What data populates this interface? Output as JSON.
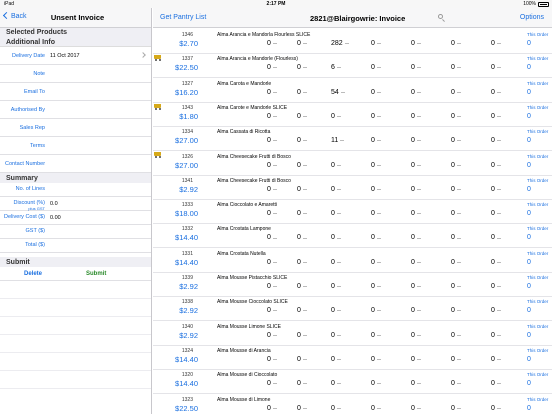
{
  "status": {
    "left": "iPad",
    "time": "2:17 PM",
    "battery": "100%"
  },
  "left_nav": {
    "back_label": "Back",
    "title": "Unsent Invoice"
  },
  "sections": {
    "selected": "Selected Products",
    "additional": "Additional Info",
    "summary": "Summary",
    "submit": "Submit"
  },
  "info_rows": [
    {
      "label": "Delivery Date",
      "value": "11 Oct 2017"
    },
    {
      "label": "Note",
      "value": ""
    },
    {
      "label": "Email To",
      "value": ""
    },
    {
      "label": "Authorised By",
      "value": ""
    },
    {
      "label": "Sales Rep",
      "value": ""
    },
    {
      "label": "Terms",
      "value": ""
    }
  ],
  "contact_label": "Contact Number",
  "summary_rows": [
    {
      "label": "No. of Lines",
      "sub": "",
      "value": ""
    },
    {
      "label": "Discount (%)",
      "sub": "plus GST",
      "value": "0.0"
    },
    {
      "label": "Delivery Cost ($)",
      "sub": "",
      "value": "0.00"
    },
    {
      "label": "GST ($)",
      "sub": "",
      "value": ""
    },
    {
      "label": "Total ($)",
      "sub": "",
      "value": ""
    }
  ],
  "buttons": {
    "delete": "Delete",
    "submit": "Submit"
  },
  "right_nav": {
    "pantry": "Get Pantry List",
    "title": "2821@Blairgowrie: Invoice",
    "options": "Options"
  },
  "order_label": "This Order",
  "products": [
    {
      "code": "1346",
      "price": "$2.70",
      "name": "Alma Arancia e Mandorla Flourless SLICE",
      "q": [
        "0",
        "0",
        "282",
        "0",
        "0",
        "0",
        "0"
      ],
      "order": "0"
    },
    {
      "code": "1337",
      "price": "$22.50",
      "name": "Alma Arancia e Mandorle (Flourless)",
      "q": [
        "0",
        "0",
        "6",
        "0",
        "0",
        "0",
        "0"
      ],
      "order": "0"
    },
    {
      "code": "1327",
      "price": "$16.20",
      "name": "Alma Carota e Mandorle",
      "q": [
        "0",
        "0",
        "54",
        "0",
        "0",
        "0",
        "0"
      ],
      "order": "0"
    },
    {
      "code": "1343",
      "price": "$1.80",
      "name": "Alma Carote e Mandorle SLICE",
      "q": [
        "0",
        "0",
        "0",
        "0",
        "0",
        "0",
        "0"
      ],
      "order": "0"
    },
    {
      "code": "1334",
      "price": "$27.00",
      "name": "Alma Cassata di Ricotta",
      "q": [
        "0",
        "0",
        "11",
        "0",
        "0",
        "0",
        "0"
      ],
      "order": "0"
    },
    {
      "code": "1326",
      "price": "$27.00",
      "name": "Alma Cheesecake Frutti di Bosco",
      "q": [
        "0",
        "0",
        "0",
        "0",
        "0",
        "0",
        "0"
      ],
      "order": "0"
    },
    {
      "code": "1341",
      "price": "$2.92",
      "name": "Alma Cheesecake Frutti di Bosco",
      "q": [
        "0",
        "0",
        "0",
        "0",
        "0",
        "0",
        "0"
      ],
      "order": "0"
    },
    {
      "code": "1333",
      "price": "$18.00",
      "name": "Alma Cioccolato e Amaretti",
      "q": [
        "0",
        "0",
        "0",
        "0",
        "0",
        "0",
        "0"
      ],
      "order": "0"
    },
    {
      "code": "1332",
      "price": "$14.40",
      "name": "Alma Crostata Lampone",
      "q": [
        "0",
        "0",
        "0",
        "0",
        "0",
        "0",
        "0"
      ],
      "order": "0"
    },
    {
      "code": "1331",
      "price": "$14.40",
      "name": "Alma Crostata Nutella",
      "q": [
        "0",
        "0",
        "0",
        "0",
        "0",
        "0",
        "0"
      ],
      "order": "0"
    },
    {
      "code": "1339",
      "price": "$2.92",
      "name": "Alma Mousse Pistacchio SLICE",
      "q": [
        "0",
        "0",
        "0",
        "0",
        "0",
        "0",
        "0"
      ],
      "order": "0"
    },
    {
      "code": "1338",
      "price": "$2.92",
      "name": "Alma Mousse Cioccolato SLICE",
      "q": [
        "0",
        "0",
        "0",
        "0",
        "0",
        "0",
        "0"
      ],
      "order": "0"
    },
    {
      "code": "1340",
      "price": "$2.92",
      "name": "Alma Mousse Limone SLICE",
      "q": [
        "0",
        "0",
        "0",
        "0",
        "0",
        "0",
        "0"
      ],
      "order": "0"
    },
    {
      "code": "1324",
      "price": "$14.40",
      "name": "Alma Mousse di Arancia",
      "q": [
        "0",
        "0",
        "0",
        "0",
        "0",
        "0",
        "0"
      ],
      "order": "0"
    },
    {
      "code": "1320",
      "price": "$14.40",
      "name": "Alma Mousse di Cioccolato",
      "q": [
        "0",
        "0",
        "0",
        "0",
        "0",
        "0",
        "0"
      ],
      "order": "0"
    },
    {
      "code": "1323",
      "price": "$22.50",
      "name": "Alma Mousse di Limone",
      "q": [
        "0",
        "0",
        "0",
        "0",
        "0",
        "0",
        "0"
      ],
      "order": "0"
    }
  ],
  "cart_rows": [
    0,
    2,
    4
  ]
}
